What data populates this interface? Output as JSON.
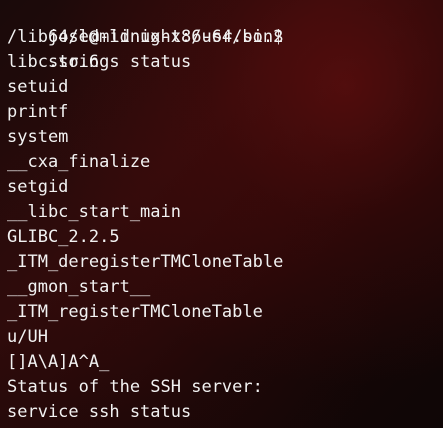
{
  "terminal": {
    "prompt": "jose@midnight:/usr/bin$",
    "command": "strings status",
    "output": [
      "/lib64/ld-linux-x86-64.so.2",
      "libc.so.6",
      "setuid",
      "printf",
      "system",
      "__cxa_finalize",
      "setgid",
      "__libc_start_main",
      "GLIBC_2.2.5",
      "_ITM_deregisterTMCloneTable",
      "__gmon_start__",
      "_ITM_registerTMCloneTable",
      "u/UH",
      "[]A\\A]A^A_",
      "Status of the SSH server:",
      "service ssh status"
    ]
  }
}
